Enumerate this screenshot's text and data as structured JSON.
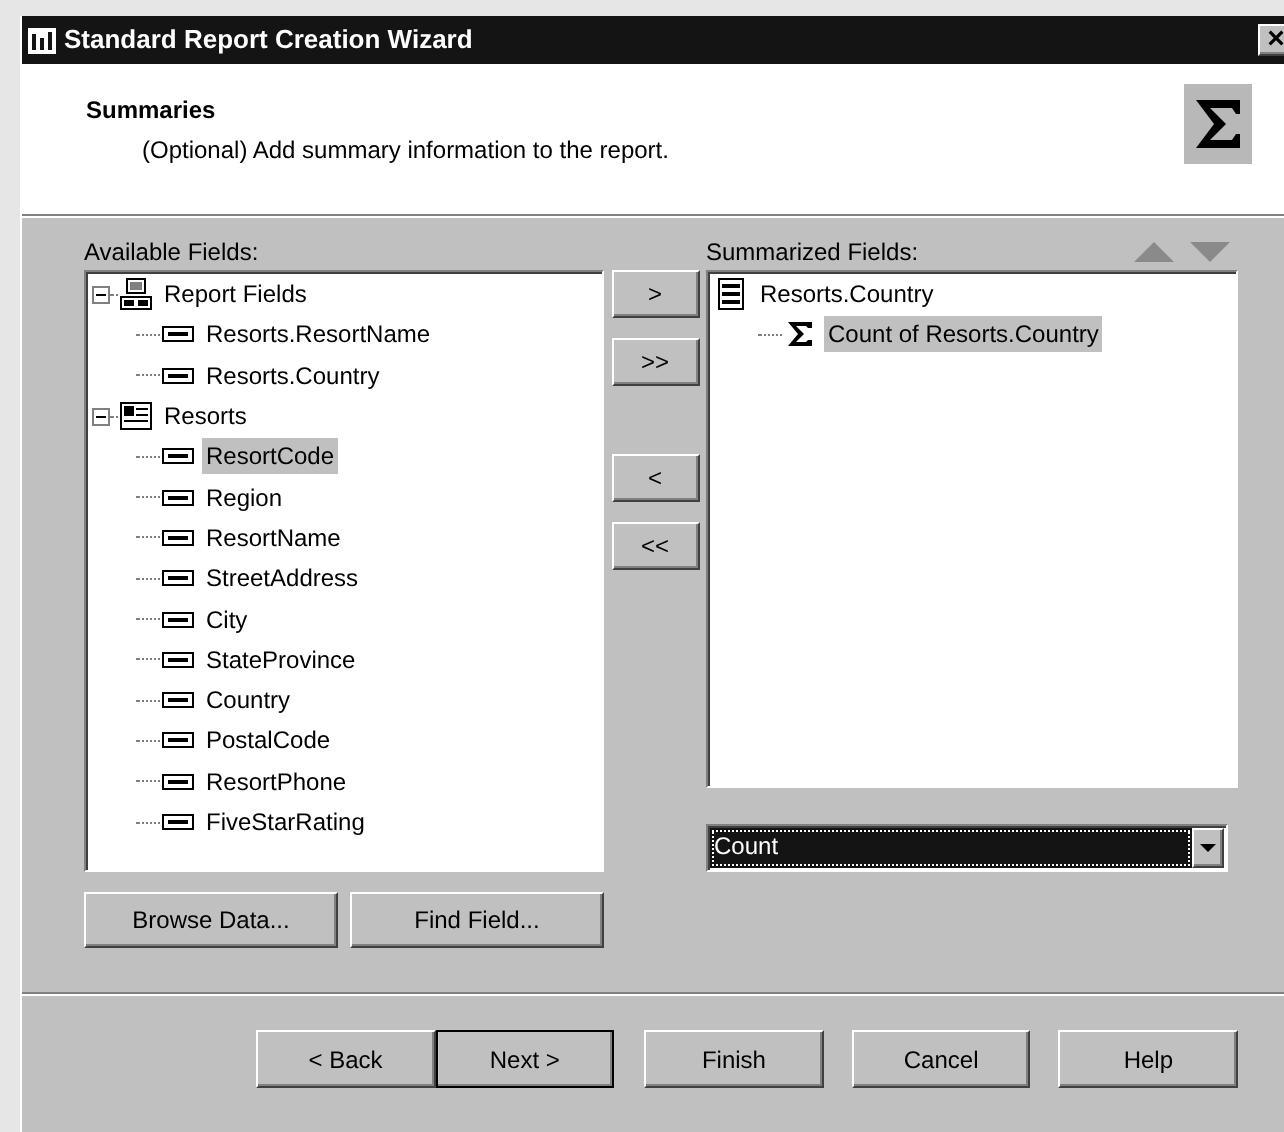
{
  "window": {
    "title": "Standard Report Creation Wizard",
    "close": "×"
  },
  "header": {
    "title": "Summaries",
    "subtitle": "(Optional) Add summary information to the report."
  },
  "available_fields": {
    "label": "Available Fields:",
    "tree": [
      {
        "label": "Report Fields",
        "kind": "report",
        "expanded": true,
        "selected": false,
        "children": [
          {
            "label": "Resorts.ResortName",
            "kind": "field",
            "selected": false
          },
          {
            "label": "Resorts.Country",
            "kind": "field",
            "selected": false
          }
        ]
      },
      {
        "label": "Resorts",
        "kind": "table",
        "expanded": true,
        "selected": false,
        "children": [
          {
            "label": "ResortCode",
            "kind": "field",
            "selected": true
          },
          {
            "label": "Region",
            "kind": "field",
            "selected": false
          },
          {
            "label": "ResortName",
            "kind": "field",
            "selected": false
          },
          {
            "label": "StreetAddress",
            "kind": "field",
            "selected": false
          },
          {
            "label": "City",
            "kind": "field",
            "selected": false
          },
          {
            "label": "StateProvince",
            "kind": "field",
            "selected": false
          },
          {
            "label": "Country",
            "kind": "field",
            "selected": false
          },
          {
            "label": "PostalCode",
            "kind": "field",
            "selected": false
          },
          {
            "label": "ResortPhone",
            "kind": "field",
            "selected": false
          },
          {
            "label": "FiveStarRating",
            "kind": "field",
            "selected": false
          }
        ]
      }
    ]
  },
  "move_buttons": [
    ">",
    ">>",
    "<",
    "<<"
  ],
  "summarized_fields": {
    "label": "Summarized Fields:",
    "tree": [
      {
        "label": "Resorts.Country",
        "kind": "group",
        "selected": false,
        "children": [
          {
            "label": "Count of Resorts.Country",
            "kind": "summary",
            "selected": true
          }
        ]
      }
    ]
  },
  "summary_operation": {
    "value": "Count"
  },
  "field_buttons": [
    "Browse Data...",
    "Find Field..."
  ],
  "footer_buttons": [
    {
      "label": "< Back",
      "default": false
    },
    {
      "label": "Next >",
      "default": true
    },
    {
      "label": "Finish",
      "default": false
    },
    {
      "label": "Cancel",
      "default": false
    },
    {
      "label": "Help",
      "default": false
    }
  ]
}
